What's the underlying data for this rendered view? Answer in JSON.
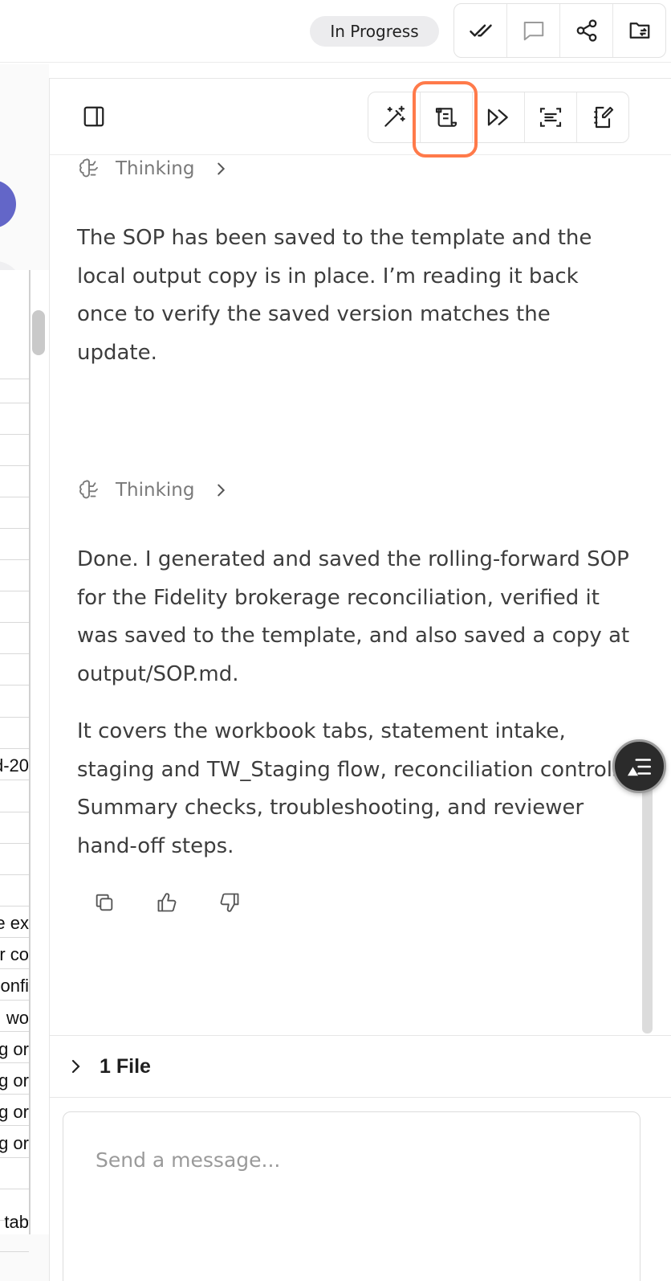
{
  "topbar": {
    "status": "In Progress",
    "actions": [
      {
        "icon": "double-check-icon"
      },
      {
        "icon": "comment-icon"
      },
      {
        "icon": "share-icon"
      },
      {
        "icon": "folder-sync-icon"
      }
    ]
  },
  "left_sheet": {
    "cells": [
      "d-20",
      "e ex",
      "r co",
      "onfi",
      "wo",
      "g or",
      "g or",
      "g or",
      "g or",
      "tab"
    ]
  },
  "panel": {
    "tools": [
      {
        "icon": "magic-wand-icon"
      },
      {
        "icon": "scroll-icon"
      },
      {
        "icon": "fast-forward-icon"
      },
      {
        "icon": "scan-text-icon"
      },
      {
        "icon": "notebook-edit-icon"
      }
    ],
    "highlight_color": "#ff7a4a",
    "thinking_label": "Thinking",
    "messages": [
      {
        "text": "The SOP has been saved to the template and the local output copy is in place. I’m reading it back once to verify the saved version matches the update."
      },
      {
        "text": "Done. I generated and saved the rolling-forward SOP for the Fidelity brokerage reconciliation, verified it was saved to the template, and also saved a copy at output/SOP.md."
      },
      {
        "text": "It covers the workbook tabs, statement intake, staging and TW_Staging flow, reconciliation controls, Summary checks, troubleshooting, and reviewer hand-off steps."
      }
    ],
    "files_label": "1 File",
    "composer_placeholder": "Send a message..."
  }
}
